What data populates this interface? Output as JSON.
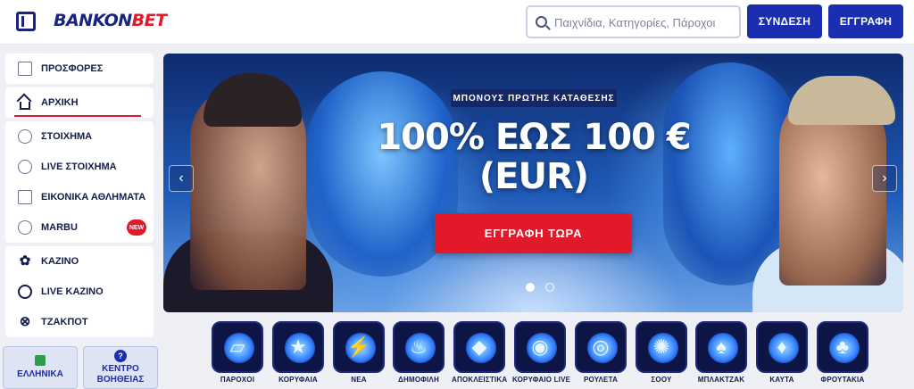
{
  "header": {
    "logo_part1": "BANKON",
    "logo_part2": "BET",
    "search_placeholder": "Παιχνίδια, Κατηγορίες, Πάροχοι",
    "login_label": "ΣΥΝΔΕΣΗ",
    "register_label": "ΕΓΓΡΑΦΗ"
  },
  "sidebar": {
    "groups": [
      [
        {
          "label": "ΠΡΟΣΦΟΡΕΣ",
          "icon": "gift-icon"
        }
      ],
      [
        {
          "label": "ΑΡΧΙΚΗ",
          "icon": "home-icon",
          "active": true
        }
      ],
      [
        {
          "label": "ΣΤΟΙΧΗΜΑ",
          "icon": "football-icon"
        },
        {
          "label": "LIVE ΣΤΟΙΧΗΜΑ",
          "icon": "live-signal-icon"
        },
        {
          "label": "ΕΙΚΟΝΙΚΑ ΑΘΛΗΜΑΤΑ",
          "icon": "monitor-icon"
        },
        {
          "label": "MARBU",
          "icon": "marbu-icon",
          "badge": "NEW"
        }
      ],
      [
        {
          "label": "ΚΑΖΙΝΟ",
          "icon": "cherries-icon"
        },
        {
          "label": "LIVE ΚΑΖΙΝΟ",
          "icon": "roulette-icon"
        },
        {
          "label": "ΤΖΑΚΠΟΤ",
          "icon": "jackpot-icon"
        }
      ]
    ],
    "language_label": "ΕΛΛΗΝΙΚΑ",
    "help_label_1": "ΚΕΝΤΡΟ",
    "help_label_2": "ΒΟΗΘΕΙΑΣ",
    "help_icon_text": "?"
  },
  "banner": {
    "tag": "ΜΠΟΝΟΥΣ ΠΡΩΤΗΣ ΚΑΤΑΘΕΣΗΣ",
    "title_line1": "100% ΕΩΣ 100 €",
    "title_line2": "(EUR)",
    "cta": "ΕΓΓΡΑΦΗ ΤΩΡΑ",
    "slide_count": 2,
    "active_slide": 1
  },
  "categories": [
    {
      "label": "ΠΑΡΟΧΟΙ",
      "icon": "providers-icon",
      "glyph": "▱"
    },
    {
      "label": "ΚΟΡΥΦΑΙΑ",
      "icon": "star-icon",
      "glyph": "★"
    },
    {
      "label": "ΝΕΑ",
      "icon": "lightning-icon",
      "glyph": "⚡"
    },
    {
      "label": "ΔΗΜΟΦΙΛΗ",
      "icon": "flame-icon",
      "glyph": "♨"
    },
    {
      "label": "ΑΠΟΚΛΕΙΣΤΙΚΑ",
      "icon": "diamond-icon",
      "glyph": "◆"
    },
    {
      "label": "ΚΟΡΥΦΑΙΟ LIVE",
      "icon": "live-top-icon",
      "glyph": "◉"
    },
    {
      "label": "ΡΟΥΛΕΤΑ",
      "icon": "roulette-wheel-icon",
      "glyph": "◎"
    },
    {
      "label": "ΣΟΟΥ",
      "icon": "show-wheel-icon",
      "glyph": "✺"
    },
    {
      "label": "ΜΠΛΑΚΤΖΑΚ",
      "icon": "cards-icon",
      "glyph": "♠"
    },
    {
      "label": "ΚΑΥΤΑ",
      "icon": "hot-drop-icon",
      "glyph": "♦"
    },
    {
      "label": "ΦΡΟΥΤΑΚΙΑ",
      "icon": "cherries-icon",
      "glyph": "♣"
    }
  ]
}
